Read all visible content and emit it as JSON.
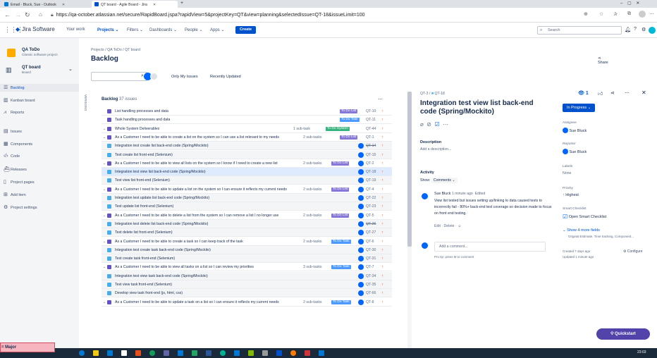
{
  "browser": {
    "tabs": [
      {
        "title": "Email - Bluck, Sue - Outlook",
        "color": "#0078d4"
      },
      {
        "title": "QT board - Agile Board - Jira",
        "color": "#0052cc"
      }
    ],
    "url": "https://qa-october.atlassian.net/secure/RapidBoard.jspa?rapidView=5&projectKey=QT&view=planning&selectedIssue=QT-18&issueLimit=100"
  },
  "jira_nav": {
    "product": "Jira Software",
    "items": [
      "Your work",
      "Projects",
      "Filters",
      "Dashboards",
      "People",
      "Apps"
    ],
    "create": "Create",
    "search_placeholder": "Search"
  },
  "sidebar": {
    "project_name": "QA ToDo",
    "project_type": "Classic software project",
    "board_name": "QT board",
    "board_sub": "Board",
    "items": [
      {
        "label": "Backlog",
        "icon": "backlog-icon"
      },
      {
        "label": "Kanban board",
        "icon": "board-icon"
      },
      {
        "label": "Reports",
        "icon": "chart-icon"
      },
      {
        "label": "Issues",
        "icon": "issues-icon"
      },
      {
        "label": "Components",
        "icon": "components-icon"
      },
      {
        "label": "Code",
        "icon": "code-icon"
      },
      {
        "label": "Releases",
        "icon": "ship-icon"
      },
      {
        "label": "Project pages",
        "icon": "pages-icon"
      },
      {
        "label": "Add item",
        "icon": "add-icon"
      },
      {
        "label": "Project settings",
        "icon": "gear-icon"
      }
    ]
  },
  "main": {
    "breadcrumb": [
      "Projects",
      "QA ToDo",
      "QT board"
    ],
    "title": "Backlog",
    "share": "Share",
    "filters": [
      "Only My Issues",
      "Recently Updated"
    ],
    "versions_label": "VERSIONS",
    "backlog_label": "Backlog",
    "backlog_count": "37 issues"
  },
  "issues": [
    {
      "summary": "List handling processes and data",
      "subtasks": "",
      "status": "To Do List",
      "key": "QT-10",
      "kind": "story",
      "avatar": false,
      "done": false
    },
    {
      "summary": "Task handling processes and data",
      "subtasks": "",
      "status": "To Do Task",
      "key": "QT-11",
      "kind": "story",
      "avatar": false,
      "done": false
    },
    {
      "summary": "Whole System Deliverables",
      "subtasks": "1 sub-task",
      "status": "To Do System",
      "key": "QT-44",
      "kind": "story",
      "avatar": false,
      "done": false
    },
    {
      "summary": "As a Customer I need to be able to create a list on the system so I can use a list relevant to my needs",
      "subtasks": "2 sub-tasks",
      "status": "To Do List",
      "key": "QT-1",
      "kind": "story",
      "avatar": false,
      "done": false
    },
    {
      "summary": "Integration test create list back-end code (Spring/Mockito)",
      "subtasks": "",
      "status": "",
      "key": "QT-14",
      "kind": "subtask",
      "avatar": true,
      "done": true
    },
    {
      "summary": "Test create list front-end (Selenium)",
      "subtasks": "",
      "status": "",
      "key": "QT-15",
      "kind": "subtask",
      "avatar": true,
      "done": false
    },
    {
      "summary": "As a Customer I need to be able to view all lists on the system so I know if I need to create a new list",
      "subtasks": "2 sub-tasks",
      "status": "To Do List",
      "key": "QT-2",
      "kind": "story",
      "avatar": true,
      "done": false
    },
    {
      "summary": "Integration test view list back-end code (Spring/Mockito)",
      "subtasks": "",
      "status": "",
      "key": "QT-18",
      "kind": "subtask",
      "avatar": true,
      "done": false,
      "selected": true
    },
    {
      "summary": "Test view list front-end (Selenium)",
      "subtasks": "",
      "status": "",
      "key": "QT-19",
      "kind": "subtask",
      "avatar": true,
      "done": false
    },
    {
      "summary": "As a Customer I need to be able to update a list on the system so I can ensure it reflects my current needs",
      "subtasks": "2 sub-tasks",
      "status": "To Do List",
      "key": "QT-4",
      "kind": "story",
      "avatar": true,
      "done": false
    },
    {
      "summary": "Integration test update list back-end code (Spring/Mockito)",
      "subtasks": "",
      "status": "",
      "key": "QT-22",
      "kind": "subtask",
      "avatar": true,
      "done": false
    },
    {
      "summary": "Test update list front-end (Selenium)",
      "subtasks": "",
      "status": "",
      "key": "QT-23",
      "kind": "subtask",
      "avatar": true,
      "done": false
    },
    {
      "summary": "As a Customer I need to be able to delete a list from the system so I can remove a list I no longer use",
      "subtasks": "2 sub-tasks",
      "status": "To Do List",
      "key": "QT-5",
      "kind": "story",
      "avatar": true,
      "done": false
    },
    {
      "summary": "Integration test delete list back-end code (Spring/Mockito)",
      "subtasks": "",
      "status": "",
      "key": "QT-26",
      "kind": "subtask",
      "avatar": true,
      "done": true
    },
    {
      "summary": "Test delete list front-end (Selenium)",
      "subtasks": "",
      "status": "",
      "key": "QT-27",
      "kind": "subtask",
      "avatar": true,
      "done": false
    },
    {
      "summary": "As a Customer I need to be able to create a task so I can keep track of the task",
      "subtasks": "2 sub-tasks",
      "status": "To Do Task",
      "key": "QT-6",
      "kind": "story",
      "avatar": true,
      "done": false
    },
    {
      "summary": "Integration test create task back-end code (Spring/Mockito)",
      "subtasks": "",
      "status": "",
      "key": "QT-30",
      "kind": "subtask",
      "avatar": true,
      "done": false
    },
    {
      "summary": "Test create task front-end (Selenium)",
      "subtasks": "",
      "status": "",
      "key": "QT-31",
      "kind": "subtask",
      "avatar": true,
      "done": false
    },
    {
      "summary": "As a Customer I need to be able to view all tasks on a list so I can review my priorities",
      "subtasks": "3 sub-tasks",
      "status": "To Do Task",
      "key": "QT-7",
      "kind": "story",
      "avatar": true,
      "done": false
    },
    {
      "summary": "Integration test view task back-end code (Spring/Mockito)",
      "subtasks": "",
      "status": "",
      "key": "QT-34",
      "kind": "subtask",
      "avatar": true,
      "done": false
    },
    {
      "summary": "Test view task front-end (Selenium)",
      "subtasks": "",
      "status": "",
      "key": "QT-35",
      "kind": "subtask",
      "avatar": true,
      "done": false
    },
    {
      "summary": "Develop view task front-end (js, html, css)",
      "subtasks": "",
      "status": "",
      "key": "QT-66",
      "kind": "subtask",
      "avatar": true,
      "done": false
    },
    {
      "summary": "As a Customer I need to be able to update a task on a list so I can ensure it reflects my current needs",
      "subtasks": "2 sub-tasks",
      "status": "To Do Task",
      "key": "QT-8",
      "kind": "story",
      "avatar": true,
      "done": false
    }
  ],
  "detail": {
    "parent_key": "QT-3",
    "key": "QT-18",
    "title": "Integration test view list back-end code (Spring/Mockito)",
    "watch_count": "1",
    "status": "In Progress",
    "description_label": "Description",
    "description_placeholder": "Add a description...",
    "activity_label": "Activity",
    "show_label": "Show:",
    "show_value": "Comments",
    "comment_author": "Sue Bluck",
    "comment_time": "1 minute ago",
    "comment_edited": "Edited",
    "comment_text": "View list tested but issues setting up/linking to data caused tests to incorrectly fail - 80%+ back-end test coverage so decision made to focus on front end testing.",
    "comment_actions": "Edit · Delete ·",
    "add_comment_placeholder": "Add a comment...",
    "pro_tip": "Pro tip: press M to comment",
    "assignee_label": "Assignee",
    "assignee": "Sue Bluck",
    "reporter_label": "Reporter",
    "reporter": "Sue Bluck",
    "labels_label": "Labels",
    "labels_value": "None",
    "priority_label": "Priority",
    "priority_value": "Highest",
    "smart_label": "Smart Checklist",
    "smart_value": "Open Smart Checklist",
    "more_fields": "Show 4 more fields",
    "more_fields_sub": "Original Estimate, Time tracking, Component...",
    "created": "Created 7 days ago",
    "updated": "Updated 1 minute ago",
    "configure": "Configure"
  },
  "overlay": {
    "major": "= Major",
    "quickstart": "Quickstart",
    "clock": "23:03"
  },
  "colors": {
    "todo_list": "#8777d9",
    "todo_task": "#4c9aff",
    "todo_system": "#36b37e",
    "story": "#6554c0",
    "subtask": "#4bade8"
  }
}
